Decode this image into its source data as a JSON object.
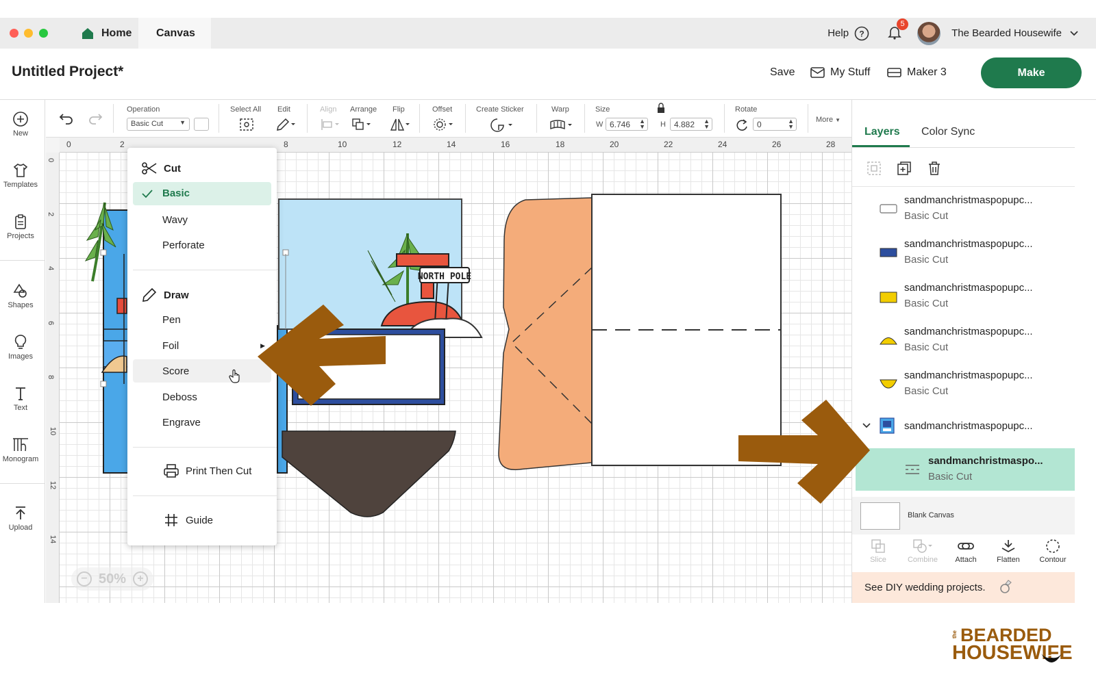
{
  "titlebar": {
    "home_label": "Home",
    "canvas_label": "Canvas",
    "help_label": "Help",
    "notification_count": "5",
    "user_name": "The Bearded Housewife"
  },
  "header": {
    "project_title": "Untitled Project*",
    "save_label": "Save",
    "mystuff_label": "My Stuff",
    "machine_label": "Maker 3",
    "make_label": "Make"
  },
  "sidebar": {
    "items": [
      {
        "label": "New",
        "icon": "plus-circle-icon"
      },
      {
        "label": "Templates",
        "icon": "shirt-icon"
      },
      {
        "label": "Projects",
        "icon": "clipboard-icon"
      },
      {
        "label": "Shapes",
        "icon": "shapes-icon"
      },
      {
        "label": "Images",
        "icon": "lightbulb-icon"
      },
      {
        "label": "Text",
        "icon": "text-icon"
      },
      {
        "label": "Monogram",
        "icon": "monogram-icon"
      },
      {
        "label": "Upload",
        "icon": "upload-icon"
      }
    ]
  },
  "toolbar": {
    "operation_label": "Operation",
    "operation_value": "Basic Cut",
    "select_all_label": "Select All",
    "edit_label": "Edit",
    "align_label": "Align",
    "arrange_label": "Arrange",
    "flip_label": "Flip",
    "offset_label": "Offset",
    "create_sticker_label": "Create Sticker",
    "warp_label": "Warp",
    "size_label": "Size",
    "w_label": "W",
    "w_value": "6.746",
    "h_label": "H",
    "h_value": "4.882",
    "rotate_label": "Rotate",
    "rotate_value": "0",
    "more_label": "More"
  },
  "ruler": {
    "top": [
      "0",
      "2",
      "8",
      "10",
      "12",
      "14",
      "16",
      "18",
      "20",
      "22",
      "24",
      "26",
      "28"
    ],
    "left": [
      "0",
      "2",
      "4",
      "6",
      "8",
      "10",
      "12",
      "14"
    ]
  },
  "zoom": {
    "value": "50%"
  },
  "operation_menu": {
    "cut_header": "Cut",
    "cut_items": [
      "Basic",
      "Wavy",
      "Perforate"
    ],
    "draw_header": "Draw",
    "draw_items": [
      "Pen",
      "Foil",
      "Score",
      "Deboss",
      "Engrave"
    ],
    "print_then_cut": "Print Then Cut",
    "guide": "Guide",
    "selected": "Basic",
    "hovered": "Score"
  },
  "canvas_art": {
    "sign_text": "NORTH POLE"
  },
  "layers_panel": {
    "tabs": [
      "Layers",
      "Color Sync"
    ],
    "layers": [
      {
        "name": "sandmanchristmaspopupc...",
        "op": "Basic Cut",
        "color": "#ffffff"
      },
      {
        "name": "sandmanchristmaspopupc...",
        "op": "Basic Cut",
        "color": "#2d4e9e"
      },
      {
        "name": "sandmanchristmaspopupc...",
        "op": "Basic Cut",
        "color": "#f2cd00"
      },
      {
        "name": "sandmanchristmaspopupc...",
        "op": "Basic Cut",
        "color": "#f2cd00"
      },
      {
        "name": "sandmanchristmaspopupc...",
        "op": "Basic Cut",
        "color": "#f2cd00"
      }
    ],
    "group_name": "sandmanchristmaspopupc...",
    "selected_layer": {
      "name": "sandmanchristmaspo...",
      "op": "Basic Cut"
    },
    "blank_canvas_label": "Blank Canvas",
    "tools": [
      "Slice",
      "Combine",
      "Attach",
      "Flatten",
      "Contour"
    ],
    "promo_text": "See DIY wedding projects."
  },
  "colors": {
    "accent": "#1f7a4d",
    "selected_layer_bg": "#b3e6d3",
    "arrow": "#9a5b0d"
  },
  "watermark": {
    "line1": "BEARDED",
    "line2": "HOUSEWIFE",
    "small": "the"
  }
}
